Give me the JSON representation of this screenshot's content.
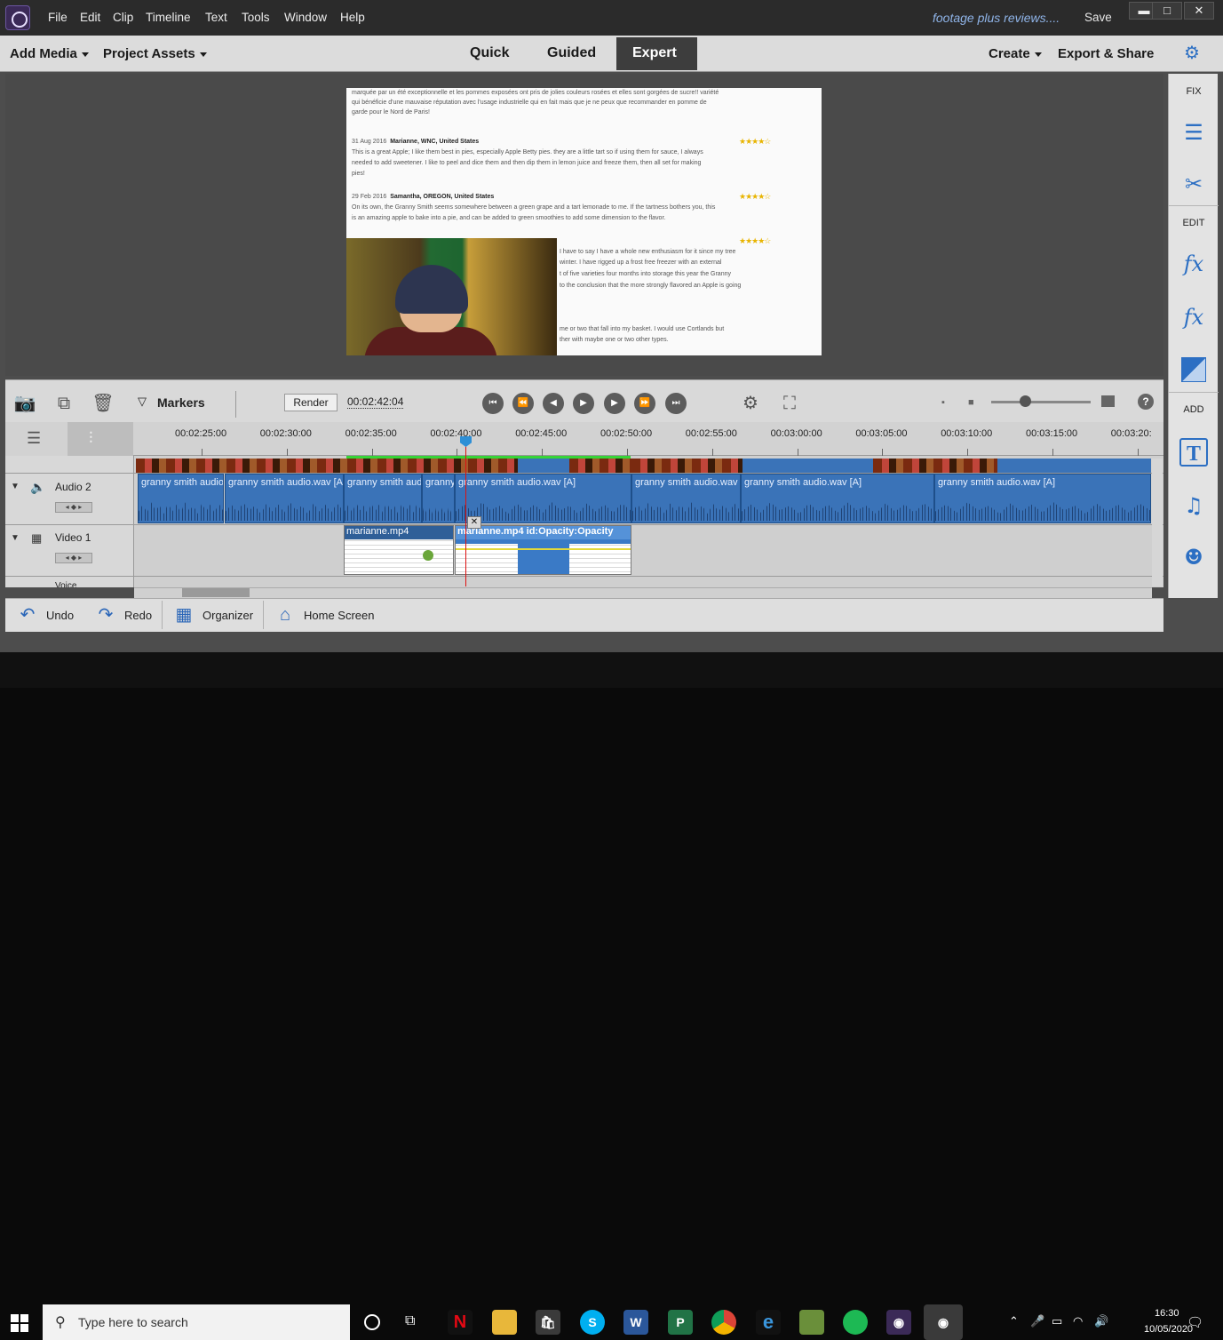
{
  "menu": [
    "File",
    "Edit",
    "Clip",
    "Timeline",
    "Text",
    "Tools",
    "Window",
    "Help"
  ],
  "title": {
    "document": "footage plus reviews....",
    "save": "Save"
  },
  "window_controls": {
    "minimize": "▬",
    "maximize": "□",
    "close": "✕"
  },
  "modebar": {
    "add_media": "Add Media",
    "project_assets": "Project Assets",
    "tabs": [
      "Quick",
      "Guided",
      "Expert"
    ],
    "active_tab": "Expert",
    "create": "Create",
    "export_share": "Export & Share"
  },
  "preview": {
    "reviews": [
      {
        "line1": "marquée par un été exceptionnelle et les pommes exposées ont pris de jolies couleurs rosées et elles sont gorgées de sucre!! variété",
        "line2": "qui bénéficie d'une mauvaise réputation avec l'usage industrielle qui en fait mais que je ne peux que recommander en pomme de",
        "line3": "garde pour le Nord de Paris!"
      },
      {
        "date": "31 Aug 2016",
        "author": "Marianne,  WNC, United States",
        "line1": "This is a great Apple; I like them best in pies, especially Apple Betty pies. they are a little tart so if using them for sauce, I always",
        "line2": "needed to add sweetener. I like to peel and dice them and then dip them in lemon juice and freeze them, then all set for making",
        "line3": "pies!"
      },
      {
        "date": "29 Feb 2016",
        "author": "Samantha,  OREGON, United States",
        "line1": "On its own, the Granny Smith seems somewhere between a green grape and a tart lemonade to me. If the tartness bothers you, this",
        "line2": "is an amazing apple to bake into a pie, and can be added to green smoothies to add some dimension to the flavor."
      },
      {
        "line1": "I have to say I have a whole new enthusiasm for it since my tree",
        "line2": "winter. I have rigged up a frost free freezer with an external",
        "line3": "t of five varieties four months into storage this year the Granny",
        "line4": "to the conclusion that the more strongly flavored an Apple is going",
        "line5": "me or two that fall into my basket. I would use Cortlands but",
        "line6": "ther with maybe one or two other types."
      }
    ]
  },
  "right_panel": {
    "fix": "FIX",
    "edit": "EDIT",
    "add": "ADD"
  },
  "timeline_toolbar": {
    "markers": "Markers",
    "render": "Render",
    "timecode": "00:02:42:04"
  },
  "ruler": {
    "ticks": [
      "00:02:25:00",
      "00:02:30:00",
      "00:02:35:00",
      "00:02:40:00",
      "00:02:45:00",
      "00:02:50:00",
      "00:02:55:00",
      "00:03:00:00",
      "00:03:05:00",
      "00:03:10:00",
      "00:03:15:00",
      "00:03:20:"
    ]
  },
  "tracks": {
    "audio2": {
      "name": "Audio 2",
      "clips": [
        "granny smith audio",
        "granny smith audio.wav [A",
        "granny smith aud",
        "granny",
        "granny smith audio.wav [A]",
        "granny smith audio.wav",
        "granny smith audio.wav [A]",
        "granny smith audio.wav [A]"
      ]
    },
    "video1": {
      "name": "Video 1",
      "clips": [
        "marianne.mp4",
        "marianne.mp4 id:Opacity:Opacity"
      ]
    },
    "voice": {
      "name": "Voice"
    }
  },
  "bottombar": {
    "undo": "Undo",
    "redo": "Redo",
    "organizer": "Organizer",
    "home": "Home Screen"
  },
  "taskbar": {
    "search_placeholder": "Type here to search",
    "time": "16:30",
    "date": "10/05/2020"
  },
  "colors": {
    "accent": "#2c6fc3",
    "playhead": "#dd1111",
    "audio_clip": "#3a73b8",
    "taskbar": "#111111"
  }
}
